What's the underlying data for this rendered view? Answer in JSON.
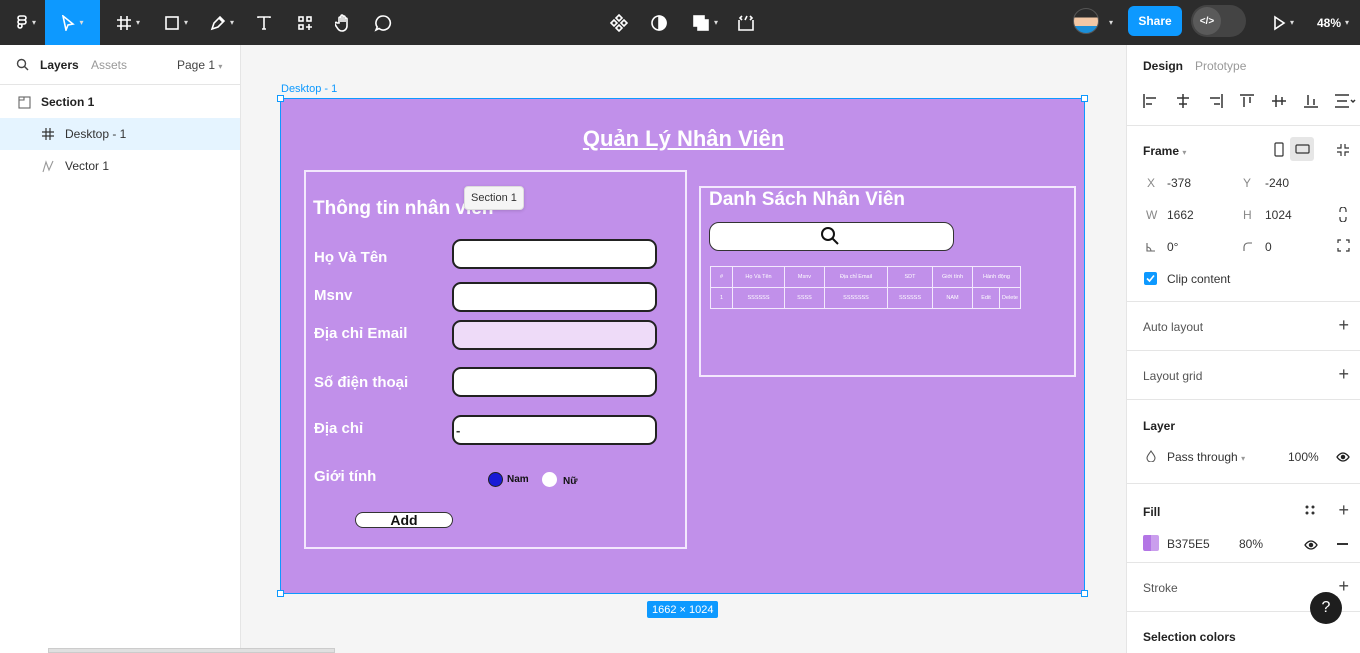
{
  "toolbar": {
    "share_label": "Share",
    "dev_mode_icon": "</>",
    "zoom_level": "48%",
    "accent_color": "#0d99ff"
  },
  "left_panel": {
    "tabs": {
      "layers": "Layers",
      "assets": "Assets",
      "page": "Page 1"
    },
    "layers": [
      {
        "name": "Section 1",
        "icon": "section-icon"
      },
      {
        "name": "Desktop - 1",
        "icon": "frame-hash-icon"
      },
      {
        "name": "Vector 1",
        "icon": "vector-icon"
      }
    ]
  },
  "canvas": {
    "frame_label": "Desktop - 1",
    "size_tag": "1662 × 1024",
    "tooltip": "Section 1",
    "app": {
      "title": "Quản Lý Nhân Viên",
      "form": {
        "title": "Thông tin nhân viên",
        "fields": [
          {
            "label": "Họ Và Tên",
            "value": ""
          },
          {
            "label": "Msnv",
            "value": ""
          },
          {
            "label": "Địa chỉ Email",
            "value": ""
          },
          {
            "label": "Số điện thoại",
            "value": ""
          },
          {
            "label": "Địa chỉ",
            "value": "-"
          }
        ],
        "gender_label": "Giới tính",
        "gender_options": [
          "Nam",
          "Nữ"
        ],
        "add_button": "Add"
      },
      "list": {
        "title": "Danh Sách Nhân Viên",
        "table": {
          "headers": [
            "#",
            "Họ Và Tên",
            "Msnv",
            "Địa chỉ Email",
            "SDT",
            "Giới tính",
            "Hành động"
          ],
          "row": [
            "1",
            "SSSSSS",
            "SSSS",
            "SSSSSSS",
            "SSSSSS",
            "NAM",
            "Edit",
            "Delete"
          ]
        }
      },
      "background_color": "#c190ea"
    }
  },
  "right_panel": {
    "tabs": {
      "design": "Design",
      "prototype": "Prototype"
    },
    "frame_title": "Frame",
    "x_label": "X",
    "x_value": "-378",
    "y_label": "Y",
    "y_value": "-240",
    "w_label": "W",
    "w_value": "1662",
    "h_label": "H",
    "h_value": "1024",
    "rotation_value": "0°",
    "radius_value": "0",
    "clip_content": "Clip content",
    "auto_layout": "Auto layout",
    "layout_grid": "Layout grid",
    "layer_title": "Layer",
    "blend_mode": "Pass through",
    "layer_opacity": "100%",
    "fill_title": "Fill",
    "fill_hex": "B375E5",
    "fill_opacity": "80%",
    "stroke_title": "Stroke",
    "selection_colors": "Selection colors"
  },
  "help": "?"
}
